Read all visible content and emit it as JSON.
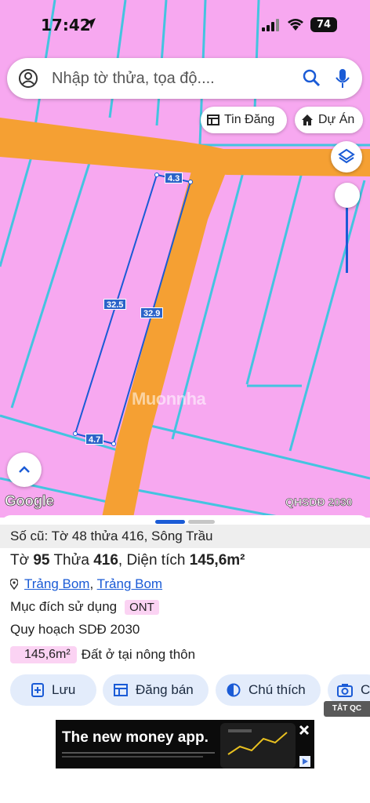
{
  "status_bar": {
    "time": "17:42",
    "battery": "74"
  },
  "search": {
    "placeholder": "Nhập tờ thửa, tọa độ...."
  },
  "chips": {
    "news": "Tin Đăng",
    "project": "Dự Án"
  },
  "map": {
    "dimensions": {
      "top": "4.3",
      "left": "32.5",
      "right": "32.9",
      "bottom": "4.7"
    },
    "google_logo": "Google",
    "layer_label": "QHSDĐ 2030",
    "watermark": "Muonnha",
    "colors": {
      "land": "#f7a8f0",
      "road": "#f5a033",
      "boundary": "#44c4e0",
      "parcel_outline": "#1a5bd6"
    }
  },
  "panel": {
    "old_info": "Số cũ: Tờ 48 thửa 416, Sông Trầu",
    "sheet_label": "Tờ",
    "sheet_no": "95",
    "parcel_label": "Thửa",
    "parcel_no": "416",
    "area_label": "Diện tích",
    "area_value": "145,6m²",
    "address_part1": "Trảng Bom",
    "address_sep": ",",
    "address_part2": "Trảng Bom",
    "purpose_label": "Mục đích sử dụng",
    "purpose_code": "ONT",
    "plan_label": "Quy hoạch SDĐ 2030",
    "plan_area": "145,6m²",
    "plan_desc": "Đất ở tại nông thôn",
    "buttons": {
      "save": "Lưu",
      "sell": "Đăng bán",
      "note": "Chú thích",
      "camera": "C"
    },
    "close_ads": "TẮT QC"
  },
  "ad": {
    "headline": "The new money app."
  }
}
